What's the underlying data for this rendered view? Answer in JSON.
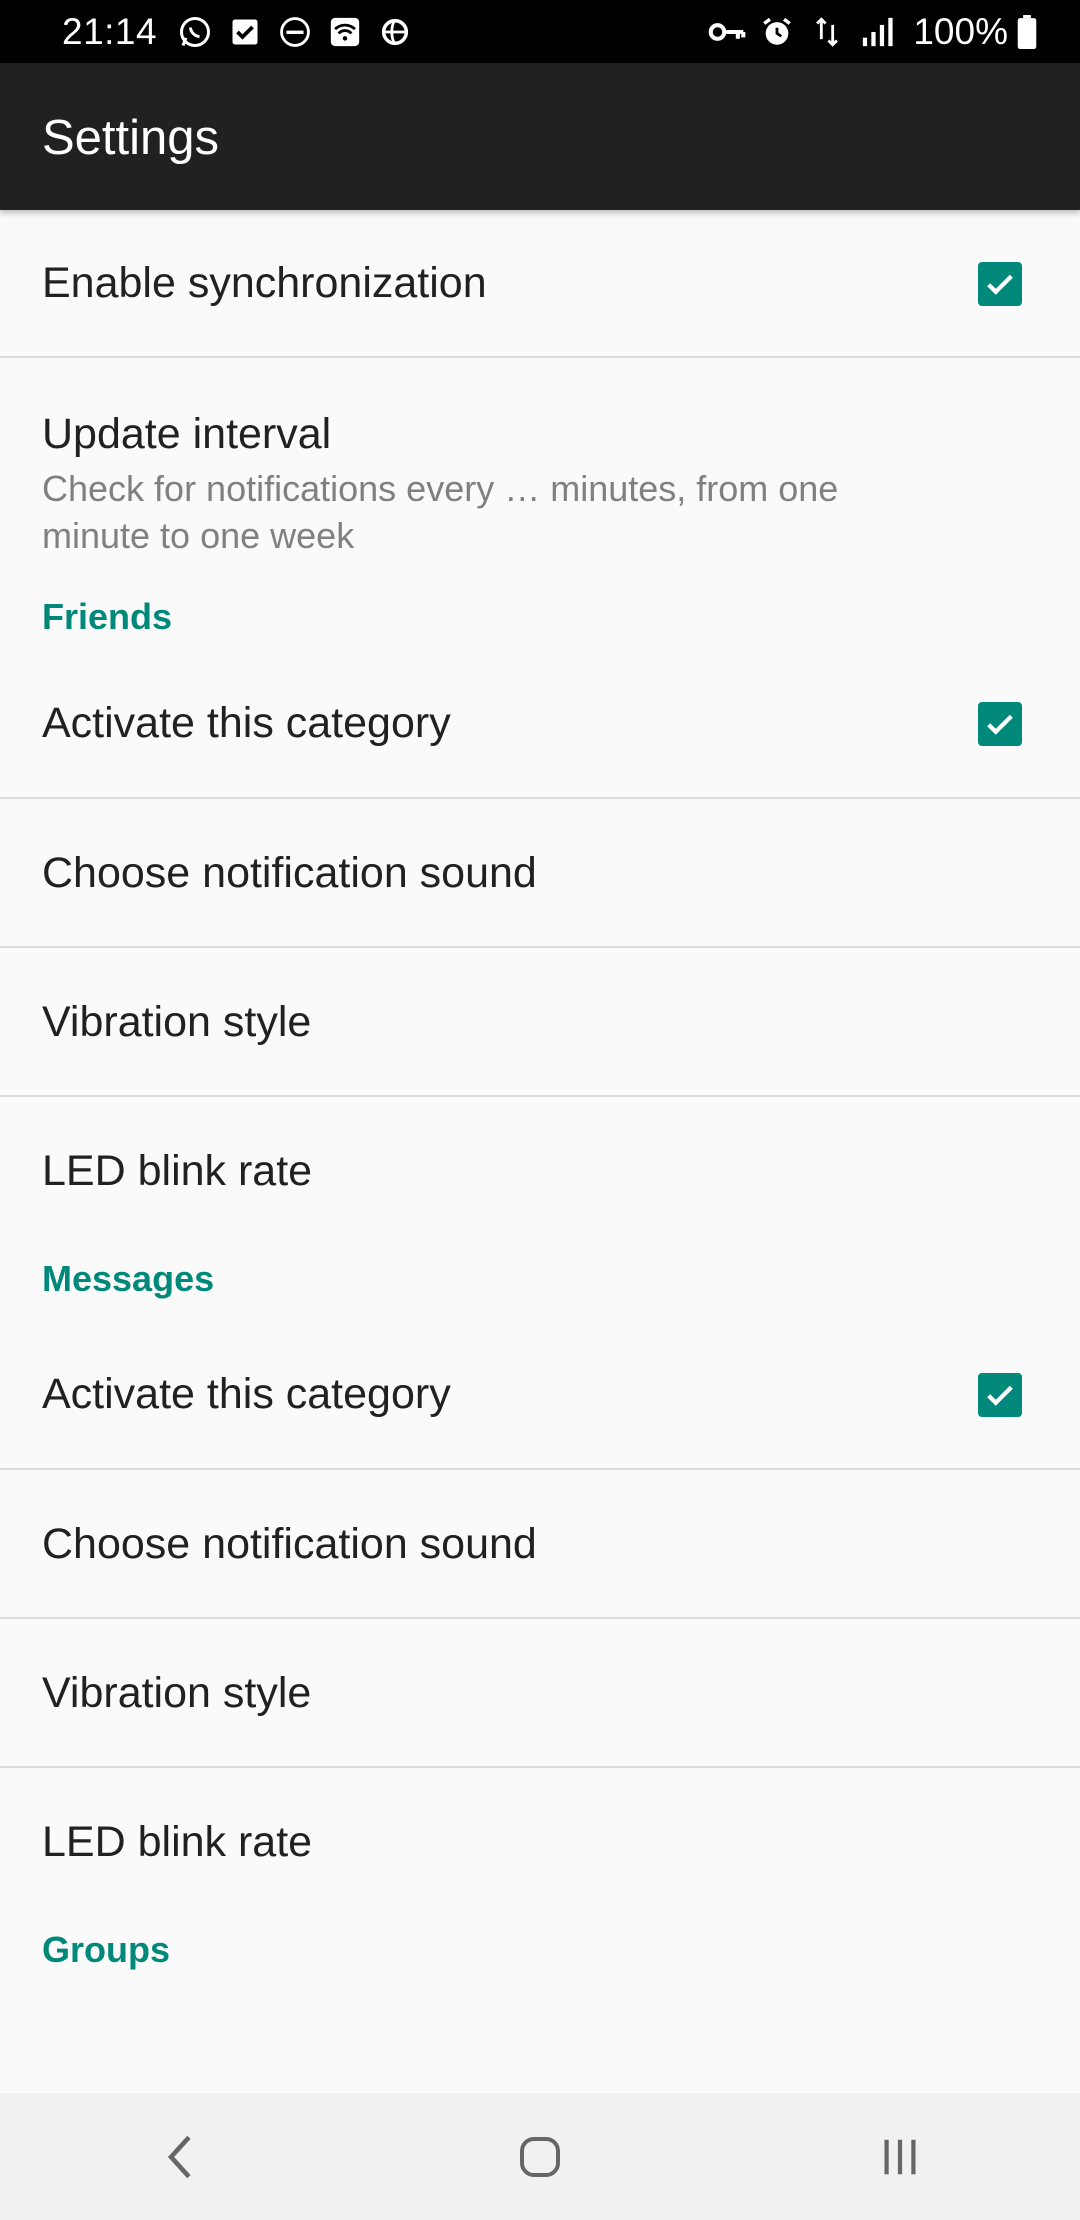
{
  "status_bar": {
    "time": "21:14",
    "left_icons": [
      "whatsapp-icon",
      "task-check-icon",
      "do-not-disturb-icon",
      "wifi-icon",
      "sync-icon"
    ],
    "right_icons": [
      "vpn-key-icon",
      "alarm-icon",
      "data-transfer-icon",
      "signal-icon",
      "battery-icon"
    ],
    "battery": "100%"
  },
  "app_bar": {
    "title": "Settings"
  },
  "settings": {
    "enable_sync": {
      "label": "Enable synchronization",
      "checked": true
    },
    "update_interval": {
      "label": "Update interval",
      "summary": "Check for notifications every … minutes, from one minute to one week"
    },
    "friends": {
      "header": "Friends",
      "activate": {
        "label": "Activate this category",
        "checked": true
      },
      "sound": "Choose notification sound",
      "vibration": "Vibration style",
      "led": "LED blink rate"
    },
    "messages": {
      "header": "Messages",
      "activate": {
        "label": "Activate this category",
        "checked": true
      },
      "sound": "Choose notification sound",
      "vibration": "Vibration style",
      "led": "LED blink rate"
    },
    "groups": {
      "header": "Groups"
    }
  },
  "nav_bar": {
    "buttons": [
      "back-icon",
      "home-icon",
      "recents-icon"
    ]
  },
  "colors": {
    "accent": "#00897b",
    "app_bar": "#212121",
    "status_bar": "#000000",
    "background": "#fafafa"
  }
}
